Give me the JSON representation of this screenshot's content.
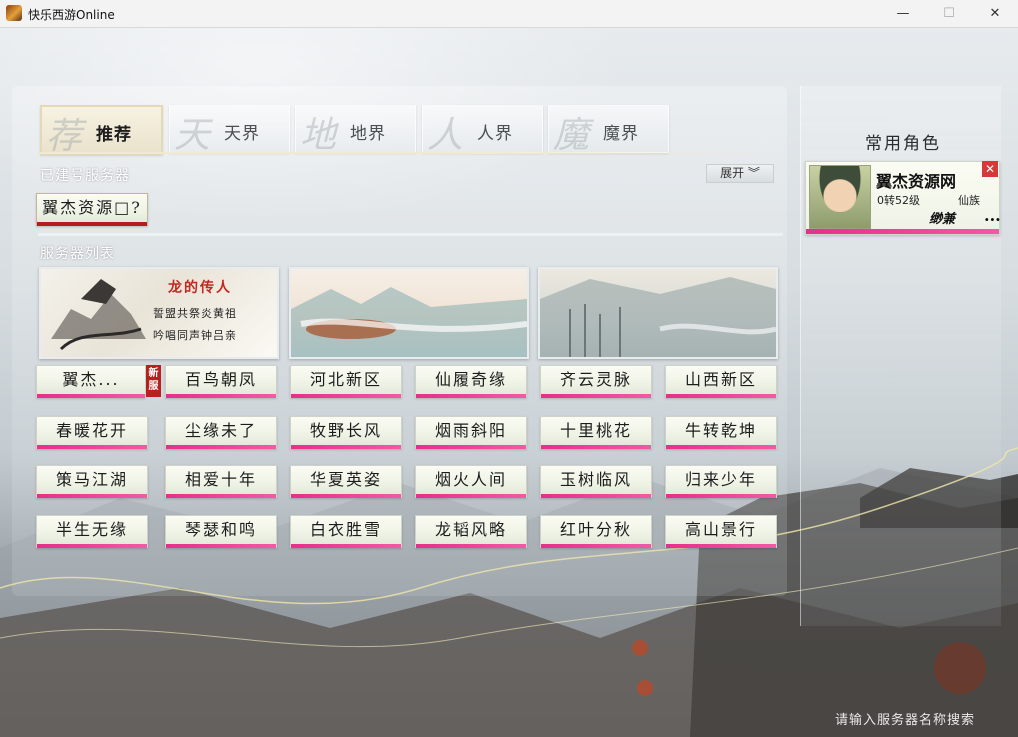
{
  "window": {
    "title": "快乐西游Online",
    "minimize": "—",
    "maximize": "☐",
    "close": "✕"
  },
  "tabs": [
    {
      "deco": "荐",
      "label": "推荐",
      "active": true
    },
    {
      "deco": "天",
      "label": "天界",
      "active": false
    },
    {
      "deco": "地",
      "label": "地界",
      "active": false
    },
    {
      "deco": "人",
      "label": "人界",
      "active": false
    },
    {
      "deco": "魔",
      "label": "魔界",
      "active": false
    }
  ],
  "built_servers": {
    "label": "已建号服务器",
    "expand_label": "展开 ︾",
    "items": [
      "翼杰资源□?"
    ]
  },
  "server_list": {
    "label": "服务器列表",
    "banners": [
      {
        "title": "龙的传人",
        "line1": "誓盟共祭炎黄祖",
        "line2": "吟唱同声钟吕亲"
      },
      {
        "title": "",
        "line1": "",
        "line2": ""
      },
      {
        "title": "",
        "line1": "",
        "line2": ""
      }
    ],
    "new_badge": "新服",
    "rows": [
      [
        "翼杰...",
        "百鸟朝凤",
        "河北新区",
        "仙履奇缘",
        "齐云灵脉",
        "山西新区"
      ],
      [
        "春暖花开",
        "尘缘未了",
        "牧野长风",
        "烟雨斜阳",
        "十里桃花",
        "牛转乾坤"
      ],
      [
        "策马江湖",
        "相爱十年",
        "华夏英姿",
        "烟火人间",
        "玉树临风",
        "归来少年"
      ],
      [
        "半生无缘",
        "琴瑟和鸣",
        "白衣胜雪",
        "龙韬风略",
        "红叶分秋",
        "高山景行"
      ]
    ]
  },
  "common_roles": {
    "title": "常用角色",
    "character": {
      "name": "翼杰资源网",
      "level": "0转52级",
      "race": "仙族",
      "signature": "缈兼",
      "more": "...",
      "close": "✕"
    }
  },
  "search_hint": "请输入服务器名称搜索",
  "colors": {
    "accent_pink": "#e72f8a",
    "built_underline": "#b51d1d",
    "new_badge": "#b91f1f",
    "close_red": "#d6393a"
  }
}
